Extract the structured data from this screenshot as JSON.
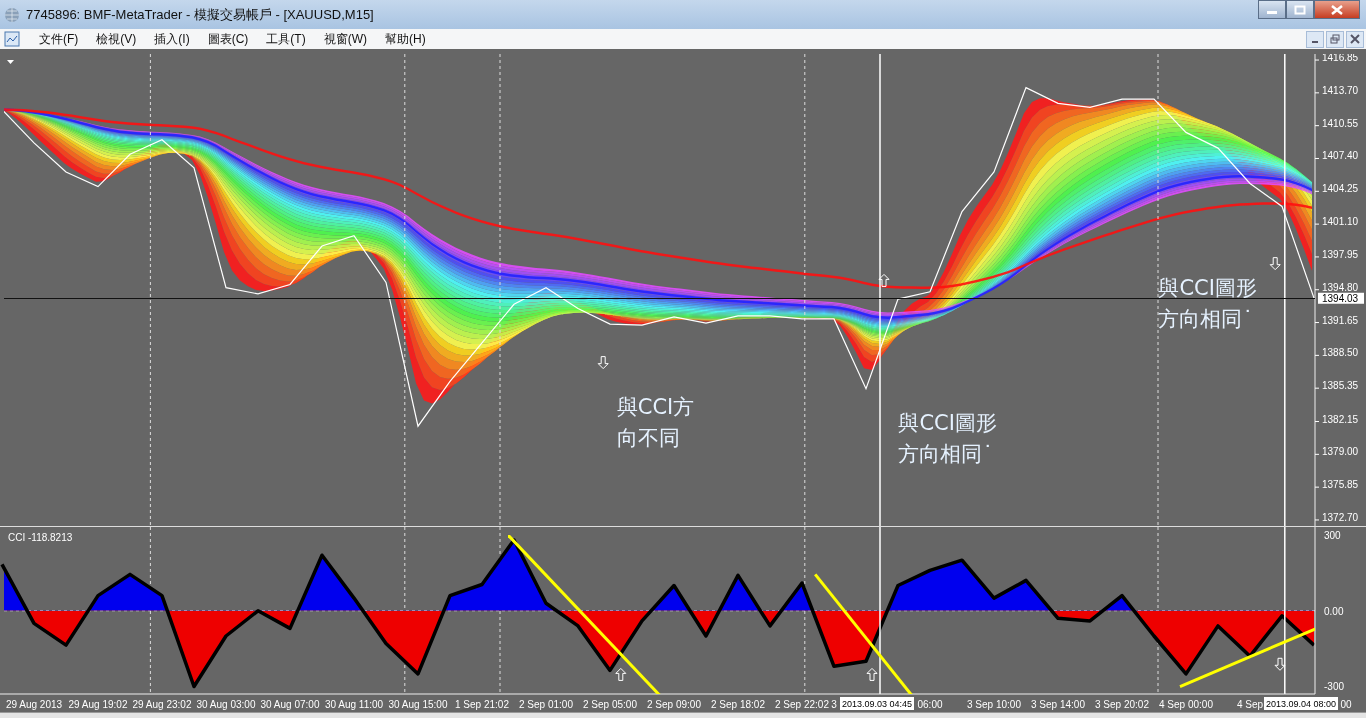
{
  "window": {
    "title": "7745896: BMF-MetaTrader - 模擬交易帳戶 - [XAUUSD,M15]"
  },
  "menu": [
    "文件(F)",
    "檢視(V)",
    "插入(I)",
    "圖表(C)",
    "工具(T)",
    "視窗(W)",
    "幫助(H)"
  ],
  "price_chart": {
    "chart_data": {
      "type": "line",
      "categories": [
        null,
        null,
        null,
        null,
        null,
        null,
        null,
        null,
        null,
        null,
        null,
        null,
        null,
        null,
        null,
        null,
        null,
        null,
        null,
        null,
        null,
        null,
        null,
        null,
        null,
        null,
        null,
        null,
        null,
        null,
        null,
        null,
        null,
        null,
        null,
        null,
        null,
        null,
        null,
        null,
        null,
        null,
        null
      ],
      "series": [
        {
          "color": "#ffffff",
          "values": [
            1412.1,
            1408.9,
            1406.1,
            1404.7,
            1407.8,
            1409.2,
            1406.5,
            1395,
            1394.4,
            1395.3,
            1399,
            1400,
            1395.5,
            1381.7,
            1386,
            1389.7,
            1393.4,
            1395,
            1393,
            1391.5,
            1391.4,
            1392.2,
            1391.6,
            1392.3,
            1392.3,
            1392,
            1392,
            1385.3,
            1393.9,
            1394.6,
            1402.3,
            1406.1,
            1414.2,
            1412.7,
            1412.3,
            1413.1,
            1413.1,
            1409.9,
            1408.4,
            1405,
            1402.8,
            1394,
            null
          ]
        }
      ],
      "ylim": [
        1372.12,
        1417.43
      ],
      "grid": true,
      "yticks": [
        {
          "value": 1416.85,
          "label": "1416.85"
        },
        {
          "value": 1413.7,
          "label": "1413.70"
        },
        {
          "value": 1410.55,
          "label": "1410.55"
        },
        {
          "value": 1407.4,
          "label": "1407.40"
        },
        {
          "value": 1404.25,
          "label": "1404.25"
        },
        {
          "value": 1401.1,
          "label": "1401.10"
        },
        {
          "value": 1397.95,
          "label": "1397.95"
        },
        {
          "value": 1394.8,
          "label": "1394.80"
        },
        {
          "value": 1391.65,
          "label": "1391.65"
        },
        {
          "value": 1388.5,
          "label": "1388.50"
        },
        {
          "value": 1385.35,
          "label": "1385.35"
        },
        {
          "value": 1382.15,
          "label": "1382.15"
        },
        {
          "value": 1379,
          "label": "1379.00"
        },
        {
          "value": 1375.85,
          "label": "1375.85"
        },
        {
          "value": 1372.7,
          "label": "1372.70"
        }
      ]
    },
    "current_price": "1394.03",
    "notes": [
      {
        "lines": [
          "與CCI方",
          "向不同"
        ]
      },
      {
        "lines": [
          "與CCI圖形",
          "方向相同˙"
        ]
      },
      {
        "lines": [
          "與CCI圖形",
          "方向相同˙"
        ]
      }
    ]
  },
  "indicator": {
    "label": "CCI -118.8213",
    "chart_data": {
      "type": "area",
      "categories": [
        null,
        "29 Aug 2013",
        null,
        "29 Aug 19:02",
        null,
        "29 Aug 23:02",
        null,
        "30 Aug 03:00",
        null,
        "30 Aug 07:00",
        null,
        "30 Aug 11:00",
        null,
        "30 Aug 15:00",
        null,
        "1 Sep 21:02",
        null,
        "2 Sep 01:00",
        null,
        "2 Sep 05:00",
        null,
        "2 Sep 09:00",
        null,
        "2 Sep 18:02",
        null,
        "2 Sep 22:02",
        "3",
        null,
        null,
        "06:00",
        null,
        "3 Sep 10:00",
        null,
        "3 Sep 14:00",
        null,
        "3 Sep 20:02",
        null,
        "4 Sep 00:00",
        null,
        "4 Sep",
        null,
        null,
        "00"
      ],
      "series": [
        {
          "color": "#000000",
          "values": [
            184,
            -50,
            -136,
            60,
            144,
            60,
            -300,
            -100,
            0,
            -70,
            220,
            50,
            -130,
            -250,
            60,
            104,
            280,
            30,
            -60,
            -236,
            -40,
            100,
            -100,
            140,
            -60,
            110,
            -220,
            -200,
            100,
            160,
            200,
            50,
            120,
            -30,
            -40,
            60,
            -100,
            -250,
            -60,
            -180,
            -20,
            -136,
            null
          ]
        }
      ],
      "ylim": [
        -329.6,
        331.6
      ],
      "grid": true,
      "yticks": [
        {
          "value": 300,
          "label": "300"
        },
        {
          "value": 0,
          "label": "0.00"
        },
        {
          "value": -300,
          "label": "-300"
        }
      ]
    }
  },
  "crosshair_time_labels": [
    "2013.09.03 04:45",
    "2013.09.04 08:00"
  ]
}
